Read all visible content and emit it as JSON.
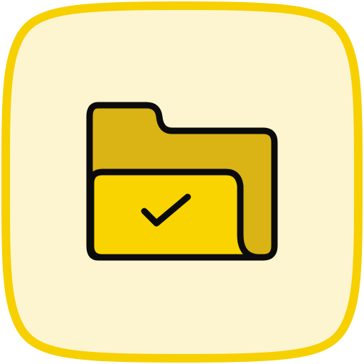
{
  "icon": {
    "name": "folder-check-icon",
    "colors": {
      "tile_background": "#FDF5CF",
      "tile_border": "#F7D000",
      "folder_back": "#DAB314",
      "folder_front": "#F9D400",
      "outline": "#0B0B0B"
    }
  }
}
